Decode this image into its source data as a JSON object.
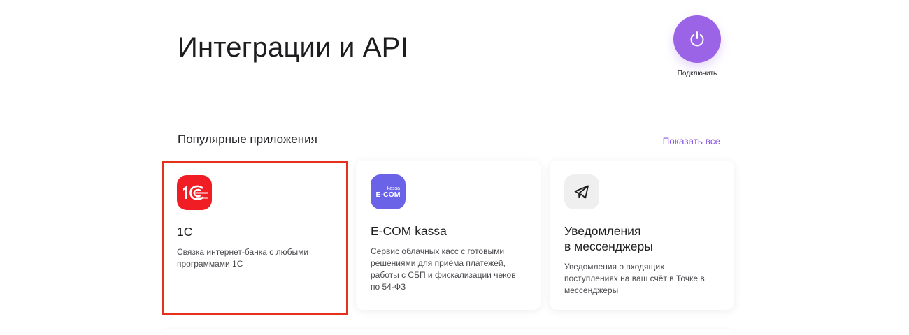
{
  "page": {
    "title": "Интеграции и API"
  },
  "connect": {
    "label": "Подключить",
    "icon": "power-icon",
    "color": "#9b63e6"
  },
  "popular": {
    "title": "Популярные приложения",
    "show_all": "Показать все"
  },
  "apps": [
    {
      "title": "1С",
      "description": "Связка интернет-банка с любыми программами 1С",
      "icon": "1c-logo",
      "icon_color": "#f01d24",
      "highlighted": true
    },
    {
      "title": "E-COM kassa",
      "description": "Сервис облачных касс с готовыми решениями для приёма платежей, работы с СБП и фискализации чеков по 54-ФЗ",
      "icon": "ecom-kassa-logo",
      "icon_color": "#6a63e8",
      "logo_text_small": "kassa",
      "logo_text_main": "E-COM"
    },
    {
      "title_line1": "Уведомления",
      "title_line2": "в мессенджеры",
      "description": "Уведомления о входящих поступлениях на ваш счёт в Точке в мессенджеры",
      "icon": "paper-plane-icon",
      "icon_color": "#efefef"
    }
  ],
  "colors": {
    "accent": "#9b63e6",
    "link": "#8c55e0",
    "highlight_border": "#e5301b"
  }
}
